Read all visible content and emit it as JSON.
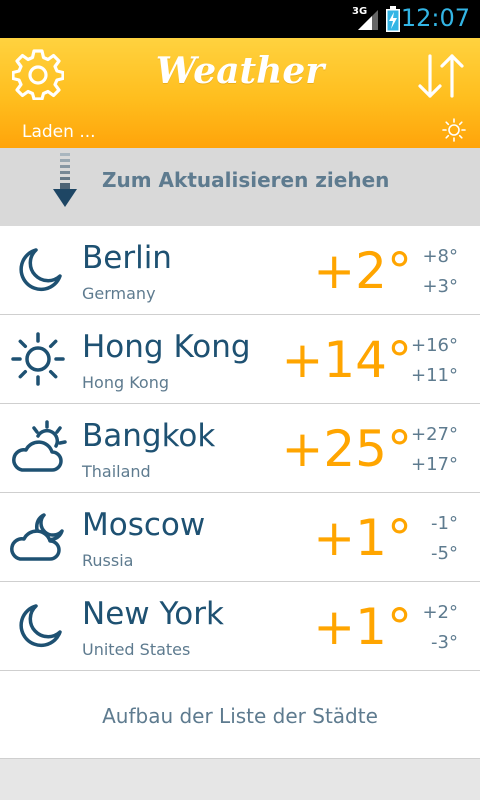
{
  "statusbar": {
    "network": "3G",
    "time": "12:07"
  },
  "header": {
    "title": "Weather",
    "loading": "Laden ..."
  },
  "pull": {
    "label": "Zum Aktualisieren ziehen"
  },
  "cities": [
    {
      "name": "Berlin",
      "country": "Germany",
      "temp": "+2°",
      "high": "+8°",
      "low": "+3°",
      "icon": "moon-icon"
    },
    {
      "name": "Hong Kong",
      "country": "Hong Kong",
      "temp": "+14°",
      "high": "+16°",
      "low": "+11°",
      "icon": "sun-icon"
    },
    {
      "name": "Bangkok",
      "country": "Thailand",
      "temp": "+25°",
      "high": "+27°",
      "low": "+17°",
      "icon": "sun-cloud-icon"
    },
    {
      "name": "Moscow",
      "country": "Russia",
      "temp": "+1°",
      "high": "-1°",
      "low": "-5°",
      "icon": "moon-cloud-icon"
    },
    {
      "name": "New York",
      "country": "United States",
      "temp": "+1°",
      "high": "+2°",
      "low": "-3°",
      "icon": "moon-icon"
    }
  ],
  "footer": {
    "label": "Aufbau der Liste der Städte"
  },
  "colors": {
    "accent": "#ffa500",
    "header_top": "#ffd23f",
    "header_bottom": "#ffa40a",
    "city_text": "#1e5172",
    "secondary_text": "#5e7b8f",
    "clock": "#33b5e5"
  }
}
